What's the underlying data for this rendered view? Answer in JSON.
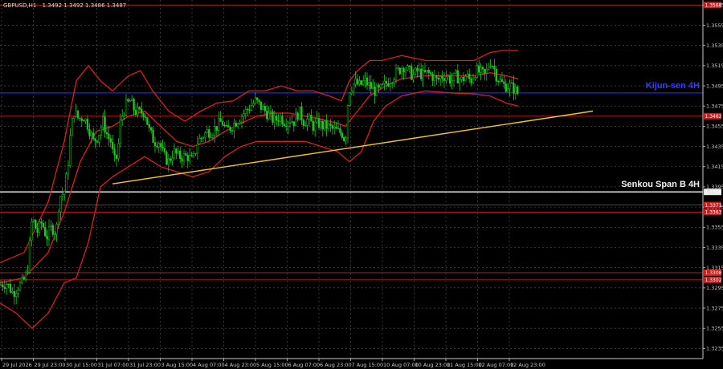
{
  "header": {
    "symbol": "GBPUSD,H1",
    "ohlc": "1.3492 1.3492 1.3486 1.3487"
  },
  "chart_data": {
    "type": "candlestick",
    "ylim": [
      1.3225,
      1.358
    ],
    "y_ticks": [
      "1.3575",
      "1.3555",
      "1.3535",
      "1.3515",
      "1.3495",
      "1.3475",
      "1.3455",
      "1.3435",
      "1.3415",
      "1.3395",
      "1.3375",
      "1.3355",
      "1.3335",
      "1.3315",
      "1.3295",
      "1.3275",
      "1.3255",
      "1.3235"
    ],
    "x_ticks": [
      "29 Jul 2026",
      "29 Jul 23:00",
      "30 Jul 15:00",
      "31 Jul 07:00",
      "31 Jul 23:00",
      "3 Aug 15:00",
      "4 Aug 07:00",
      "4 Aug 23:00",
      "5 Aug 15:00",
      "6 Aug 07:00",
      "6 Aug 23:00",
      "7 Aug 15:00",
      "10 Aug 07:00",
      "10 Aug 23:00",
      "11 Aug 15:00",
      "12 Aug 07:00",
      "12 Aug 23:00"
    ],
    "price_path": [
      [
        0,
        1.3298
      ],
      [
        8,
        1.33
      ],
      [
        16,
        1.329
      ],
      [
        22,
        1.3296
      ],
      [
        28,
        1.33
      ],
      [
        34,
        1.331
      ],
      [
        40,
        1.3365
      ],
      [
        46,
        1.335
      ],
      [
        52,
        1.336
      ],
      [
        58,
        1.3345
      ],
      [
        64,
        1.3355
      ],
      [
        70,
        1.335
      ],
      [
        74,
        1.3385
      ],
      [
        80,
        1.339
      ],
      [
        84,
        1.341
      ],
      [
        88,
        1.345
      ],
      [
        92,
        1.347
      ],
      [
        98,
        1.3462
      ],
      [
        104,
        1.3465
      ],
      [
        110,
        1.3455
      ],
      [
        116,
        1.344
      ],
      [
        122,
        1.3445
      ],
      [
        128,
        1.346
      ],
      [
        134,
        1.3445
      ],
      [
        138,
        1.344
      ],
      [
        142,
        1.342
      ],
      [
        146,
        1.3425
      ],
      [
        150,
        1.346
      ],
      [
        156,
        1.3475
      ],
      [
        162,
        1.348
      ],
      [
        168,
        1.347
      ],
      [
        174,
        1.3468
      ],
      [
        180,
        1.347
      ],
      [
        186,
        1.345
      ],
      [
        192,
        1.344
      ],
      [
        198,
        1.344
      ],
      [
        204,
        1.3425
      ],
      [
        210,
        1.342
      ],
      [
        216,
        1.343
      ],
      [
        222,
        1.3425
      ],
      [
        228,
        1.3425
      ],
      [
        234,
        1.3425
      ],
      [
        240,
        1.342
      ],
      [
        246,
        1.344
      ],
      [
        252,
        1.3445
      ],
      [
        258,
        1.345
      ],
      [
        264,
        1.345
      ],
      [
        270,
        1.3455
      ],
      [
        276,
        1.346
      ],
      [
        282,
        1.345
      ],
      [
        288,
        1.3455
      ],
      [
        294,
        1.346
      ],
      [
        300,
        1.3465
      ],
      [
        306,
        1.347
      ],
      [
        312,
        1.3475
      ],
      [
        318,
        1.348
      ],
      [
        324,
        1.3475
      ],
      [
        330,
        1.347
      ],
      [
        336,
        1.3465
      ],
      [
        342,
        1.346
      ],
      [
        348,
        1.3465
      ],
      [
        354,
        1.346
      ],
      [
        360,
        1.3462
      ],
      [
        366,
        1.346
      ],
      [
        372,
        1.347
      ],
      [
        378,
        1.346
      ],
      [
        384,
        1.3462
      ],
      [
        390,
        1.3455
      ],
      [
        396,
        1.3458
      ],
      [
        402,
        1.3455
      ],
      [
        408,
        1.3455
      ],
      [
        414,
        1.3452
      ],
      [
        420,
        1.345
      ],
      [
        426,
        1.3448
      ],
      [
        430,
        1.344
      ],
      [
        434,
        1.349
      ],
      [
        438,
        1.3495
      ],
      [
        442,
        1.3498
      ],
      [
        448,
        1.3495
      ],
      [
        454,
        1.35
      ],
      [
        460,
        1.3495
      ],
      [
        466,
        1.349
      ],
      [
        472,
        1.349
      ],
      [
        478,
        1.3495
      ],
      [
        484,
        1.35
      ],
      [
        490,
        1.3505
      ],
      [
        496,
        1.351
      ],
      [
        502,
        1.3515
      ],
      [
        508,
        1.351
      ],
      [
        514,
        1.3505
      ],
      [
        520,
        1.351
      ],
      [
        526,
        1.3505
      ],
      [
        532,
        1.3508
      ],
      [
        538,
        1.3505
      ],
      [
        544,
        1.35
      ],
      [
        550,
        1.3505
      ],
      [
        556,
        1.3505
      ],
      [
        562,
        1.35
      ],
      [
        568,
        1.3505
      ],
      [
        574,
        1.35
      ],
      [
        580,
        1.3505
      ],
      [
        586,
        1.35
      ],
      [
        592,
        1.351
      ],
      [
        598,
        1.3508
      ],
      [
        604,
        1.3505
      ],
      [
        610,
        1.352
      ],
      [
        614,
        1.3515
      ],
      [
        618,
        1.3505
      ],
      [
        622,
        1.35
      ],
      [
        628,
        1.3495
      ],
      [
        634,
        1.3495
      ],
      [
        640,
        1.3492
      ],
      [
        645,
        1.3487
      ]
    ],
    "bollinger_upper": [
      [
        0,
        1.332
      ],
      [
        30,
        1.333
      ],
      [
        60,
        1.338
      ],
      [
        80,
        1.344
      ],
      [
        95,
        1.35
      ],
      [
        110,
        1.3515
      ],
      [
        125,
        1.35
      ],
      [
        140,
        1.349
      ],
      [
        160,
        1.3505
      ],
      [
        175,
        1.351
      ],
      [
        190,
        1.349
      ],
      [
        210,
        1.347
      ],
      [
        230,
        1.346
      ],
      [
        250,
        1.347
      ],
      [
        270,
        1.3478
      ],
      [
        290,
        1.348
      ],
      [
        310,
        1.349
      ],
      [
        330,
        1.349
      ],
      [
        350,
        1.3495
      ],
      [
        370,
        1.349
      ],
      [
        390,
        1.349
      ],
      [
        410,
        1.3485
      ],
      [
        425,
        1.348
      ],
      [
        435,
        1.35
      ],
      [
        445,
        1.351
      ],
      [
        460,
        1.352
      ],
      [
        475,
        1.352
      ],
      [
        500,
        1.3525
      ],
      [
        530,
        1.352
      ],
      [
        560,
        1.352
      ],
      [
        590,
        1.352
      ],
      [
        610,
        1.3528
      ],
      [
        625,
        1.353
      ],
      [
        645,
        1.353
      ]
    ],
    "bollinger_middle": [
      [
        0,
        1.33
      ],
      [
        30,
        1.3305
      ],
      [
        60,
        1.333
      ],
      [
        80,
        1.337
      ],
      [
        100,
        1.342
      ],
      [
        120,
        1.345
      ],
      [
        140,
        1.3455
      ],
      [
        160,
        1.3465
      ],
      [
        180,
        1.347
      ],
      [
        200,
        1.3455
      ],
      [
        220,
        1.344
      ],
      [
        240,
        1.3435
      ],
      [
        260,
        1.344
      ],
      [
        280,
        1.345
      ],
      [
        300,
        1.3458
      ],
      [
        320,
        1.3465
      ],
      [
        340,
        1.3468
      ],
      [
        360,
        1.3468
      ],
      [
        380,
        1.3465
      ],
      [
        400,
        1.3462
      ],
      [
        420,
        1.3458
      ],
      [
        430,
        1.3455
      ],
      [
        445,
        1.347
      ],
      [
        460,
        1.3485
      ],
      [
        480,
        1.3495
      ],
      [
        500,
        1.3502
      ],
      [
        530,
        1.3505
      ],
      [
        560,
        1.3505
      ],
      [
        590,
        1.3505
      ],
      [
        610,
        1.3508
      ],
      [
        630,
        1.3505
      ],
      [
        645,
        1.3502
      ]
    ],
    "bollinger_lower": [
      [
        0,
        1.328
      ],
      [
        20,
        1.327
      ],
      [
        40,
        1.3255
      ],
      [
        60,
        1.327
      ],
      [
        80,
        1.33
      ],
      [
        95,
        1.3305
      ],
      [
        110,
        1.334
      ],
      [
        125,
        1.3395
      ],
      [
        140,
        1.3405
      ],
      [
        160,
        1.3415
      ],
      [
        180,
        1.3425
      ],
      [
        200,
        1.3415
      ],
      [
        220,
        1.341
      ],
      [
        240,
        1.3405
      ],
      [
        260,
        1.341
      ],
      [
        280,
        1.3425
      ],
      [
        300,
        1.3435
      ],
      [
        320,
        1.344
      ],
      [
        340,
        1.344
      ],
      [
        360,
        1.344
      ],
      [
        380,
        1.344
      ],
      [
        400,
        1.3435
      ],
      [
        420,
        1.343
      ],
      [
        435,
        1.342
      ],
      [
        450,
        1.343
      ],
      [
        465,
        1.346
      ],
      [
        480,
        1.3475
      ],
      [
        500,
        1.3485
      ],
      [
        530,
        1.349
      ],
      [
        560,
        1.3488
      ],
      [
        590,
        1.3487
      ],
      [
        610,
        1.3485
      ],
      [
        630,
        1.3478
      ],
      [
        645,
        1.3475
      ]
    ],
    "trendline": {
      "start": [
        140,
        1.3398
      ],
      "end": [
        738,
        1.347
      ],
      "color": "#f5c518"
    },
    "levels": [
      {
        "price": 1.3575,
        "color": "#c81e1e",
        "label": "1.3568"
      },
      {
        "price": 1.3488,
        "color": "#1e1ef5",
        "label": "",
        "text": "Kijun-sen 4H",
        "thick": true
      },
      {
        "price": 1.3465,
        "color": "#c81e1e",
        "label": "1.3462"
      },
      {
        "price": 1.339,
        "color": "#e6e6e6",
        "label": "1.3388",
        "text": "Senkou Span B 4H",
        "thick": true
      },
      {
        "price": 1.3377,
        "color": "#c81e1e",
        "label": "1.3371"
      },
      {
        "price": 1.337,
        "color": "#c81e1e",
        "label": "1.3363"
      },
      {
        "price": 1.331,
        "color": "#c81e1e",
        "label": "1.3308"
      },
      {
        "price": 1.3303,
        "color": "#c81e1e",
        "label": "1.3302"
      }
    ],
    "grid": true,
    "colors": {
      "background": "#000000",
      "candles": "#1ec81e",
      "bollinger": "#dc1e1e",
      "grid": "#5a5a5a",
      "axis": "#c8c8c8"
    }
  }
}
